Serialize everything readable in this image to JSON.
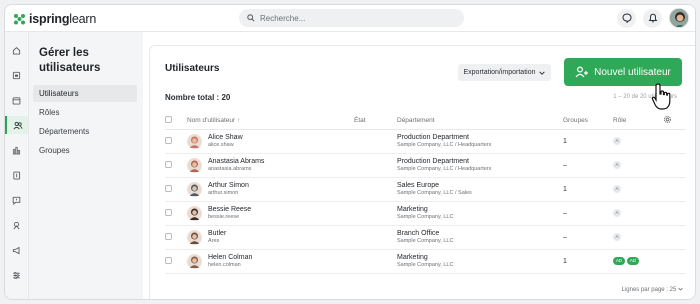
{
  "brand": {
    "name_bold": "ispring",
    "name_light": "learn",
    "accent": "#2fa958"
  },
  "search": {
    "placeholder": "Recherche..."
  },
  "topbar": {
    "icons": [
      "chat-icon",
      "bell-icon",
      "user-avatar"
    ]
  },
  "rail": {
    "icons": [
      "home-icon",
      "courses-icon",
      "calendar-icon",
      "users-icon",
      "reports-icon",
      "book-icon",
      "feedback-icon",
      "skills-icon",
      "announcements-icon",
      "settings-icon"
    ],
    "active_index": 3
  },
  "subnav": {
    "title": "Gérer les utilisateurs",
    "items": [
      {
        "label": "Utilisateurs",
        "active": true
      },
      {
        "label": "Rôles"
      },
      {
        "label": "Départements"
      },
      {
        "label": "Groupes"
      }
    ]
  },
  "main": {
    "title": "Utilisateurs",
    "export_label": "Exportation/importation",
    "new_user_label": "Nouvel utilisateur",
    "total_label": "Nombre total : 20",
    "range_label": "1 – 20 de 20 utilisateurs",
    "page_size_label": "Lignes par page : 25"
  },
  "table": {
    "headers": {
      "name": "Nom d'utilisateur",
      "state": "État",
      "department": "Département",
      "groups": "Groupes",
      "role": "Rôle"
    },
    "rows": [
      {
        "name": "Alice Shaw",
        "login": "alice.shaw",
        "dept": "Production Department",
        "dept_path": "Sample Company, LLC / Headquarters",
        "groups": "1",
        "role": "A",
        "avatar_color": "#c9735c"
      },
      {
        "name": "Anastasia Abrams",
        "login": "anastasia.abrams",
        "dept": "Production Department",
        "dept_path": "Sample Company, LLC / Headquarters",
        "groups": "–",
        "role": "A",
        "avatar_color": "#b0664f"
      },
      {
        "name": "Arthur Simon",
        "login": "arthur.simon",
        "dept": "Sales Europe",
        "dept_path": "Sample Company, LLC / Sales",
        "groups": "1",
        "role": "A",
        "avatar_color": "#4a5a6d"
      },
      {
        "name": "Bessie Reese",
        "login": "bessie.reese",
        "dept": "Marketing",
        "dept_path": "Sample Company, LLC",
        "groups": "–",
        "role": "A",
        "avatar_color": "#3d2a22"
      },
      {
        "name": "Butler",
        "login": "Ares",
        "dept": "Branch Office",
        "dept_path": "Sample Company, LLC",
        "groups": "–",
        "role": "A",
        "avatar_color": "#6e4b3a"
      },
      {
        "name": "Helen Colman",
        "login": "helen.colman",
        "dept": "Marketing",
        "dept_path": "Sample Company, LLC",
        "groups": "1",
        "role": "AD AD",
        "avatar_color": "#8a5b45"
      }
    ]
  }
}
